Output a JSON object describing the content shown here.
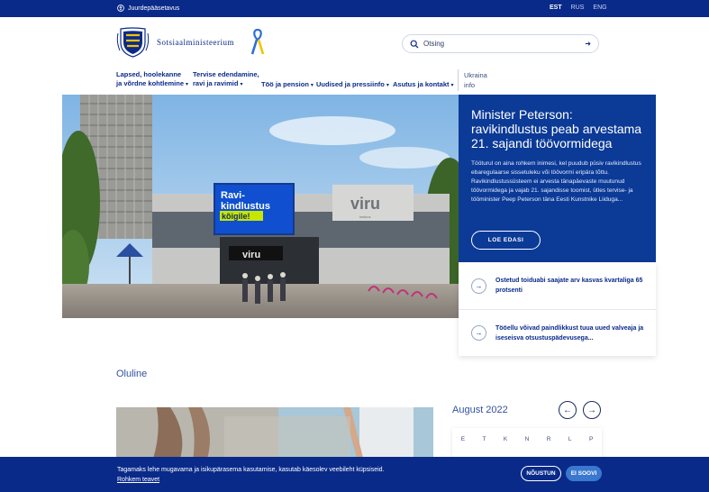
{
  "topbar": {
    "accessibility": "Juurdepääsetavus",
    "languages": [
      {
        "code": "EST",
        "active": true
      },
      {
        "code": "RUS",
        "active": false
      },
      {
        "code": "ENG",
        "active": false
      }
    ]
  },
  "header": {
    "ministry_name": "Sotsiaalministeerium",
    "search_placeholder": "Otsing"
  },
  "nav": {
    "items": [
      {
        "line1": "Lapsed, hoolekanne",
        "line2": "ja võrdne kohtlemine"
      },
      {
        "line1": "Tervise edendamine,",
        "line2": "ravi ja ravimid"
      },
      {
        "line1": "",
        "line2": "Töö ja pension"
      },
      {
        "line1": "",
        "line2": "Uudised ja pressiinfo"
      },
      {
        "line1": "",
        "line2": "Asutus ja kontakt"
      }
    ],
    "ukraina": {
      "line1": "Ukraina",
      "line2": "info"
    }
  },
  "hero": {
    "billboard_line1": "Ravi-",
    "billboard_line2": "kindlustus",
    "billboard_line3": "kõigile!",
    "sign_main": "viru",
    "sign_sub": "keskus",
    "sign_entrance": "viru"
  },
  "feature": {
    "title": "Minister Peterson: ravikindlustus peab arvestama 21. sajandi töövormidega",
    "body": "Tööturul on aina rohkem inimesi, kel puudub püsiv ravikindlustus ebaregulaarse sissetuleku või töövormi eripära tõttu. Ravikindlustussüsteem ei arvesta tänapäevaste muutunud töövormidega ja vajab 21. sajandisse toomist, ütles tervise- ja tööminister Peep Peterson täna Eesti Kunstnike Liiduga...",
    "button": "LOE EDASI"
  },
  "news": [
    {
      "text": "Ostetud toiduabi saajate arv kasvas kvartaliga 65 protsenti"
    },
    {
      "text": "Tööellu võivad paindlikkust tuua uued valveaja ja iseseisva otsustuspädevusega..."
    }
  ],
  "section_title": "Oluline",
  "calendar": {
    "month": "August 2022",
    "days": [
      "E",
      "T",
      "K",
      "N",
      "R",
      "L",
      "P"
    ]
  },
  "cookie": {
    "message": "Tagamaks lehe mugavama ja isikupärasema kasutamise, kasutab käesolev veebileht küpsiseid.",
    "more": "Rohkem teavet",
    "accept": "NÕUSTUN",
    "deny": "EI SOOVI"
  },
  "colors": {
    "brand": "#0a2a8a",
    "feature_bg": "#0b3a97",
    "deny_button": "#3a78d0"
  }
}
